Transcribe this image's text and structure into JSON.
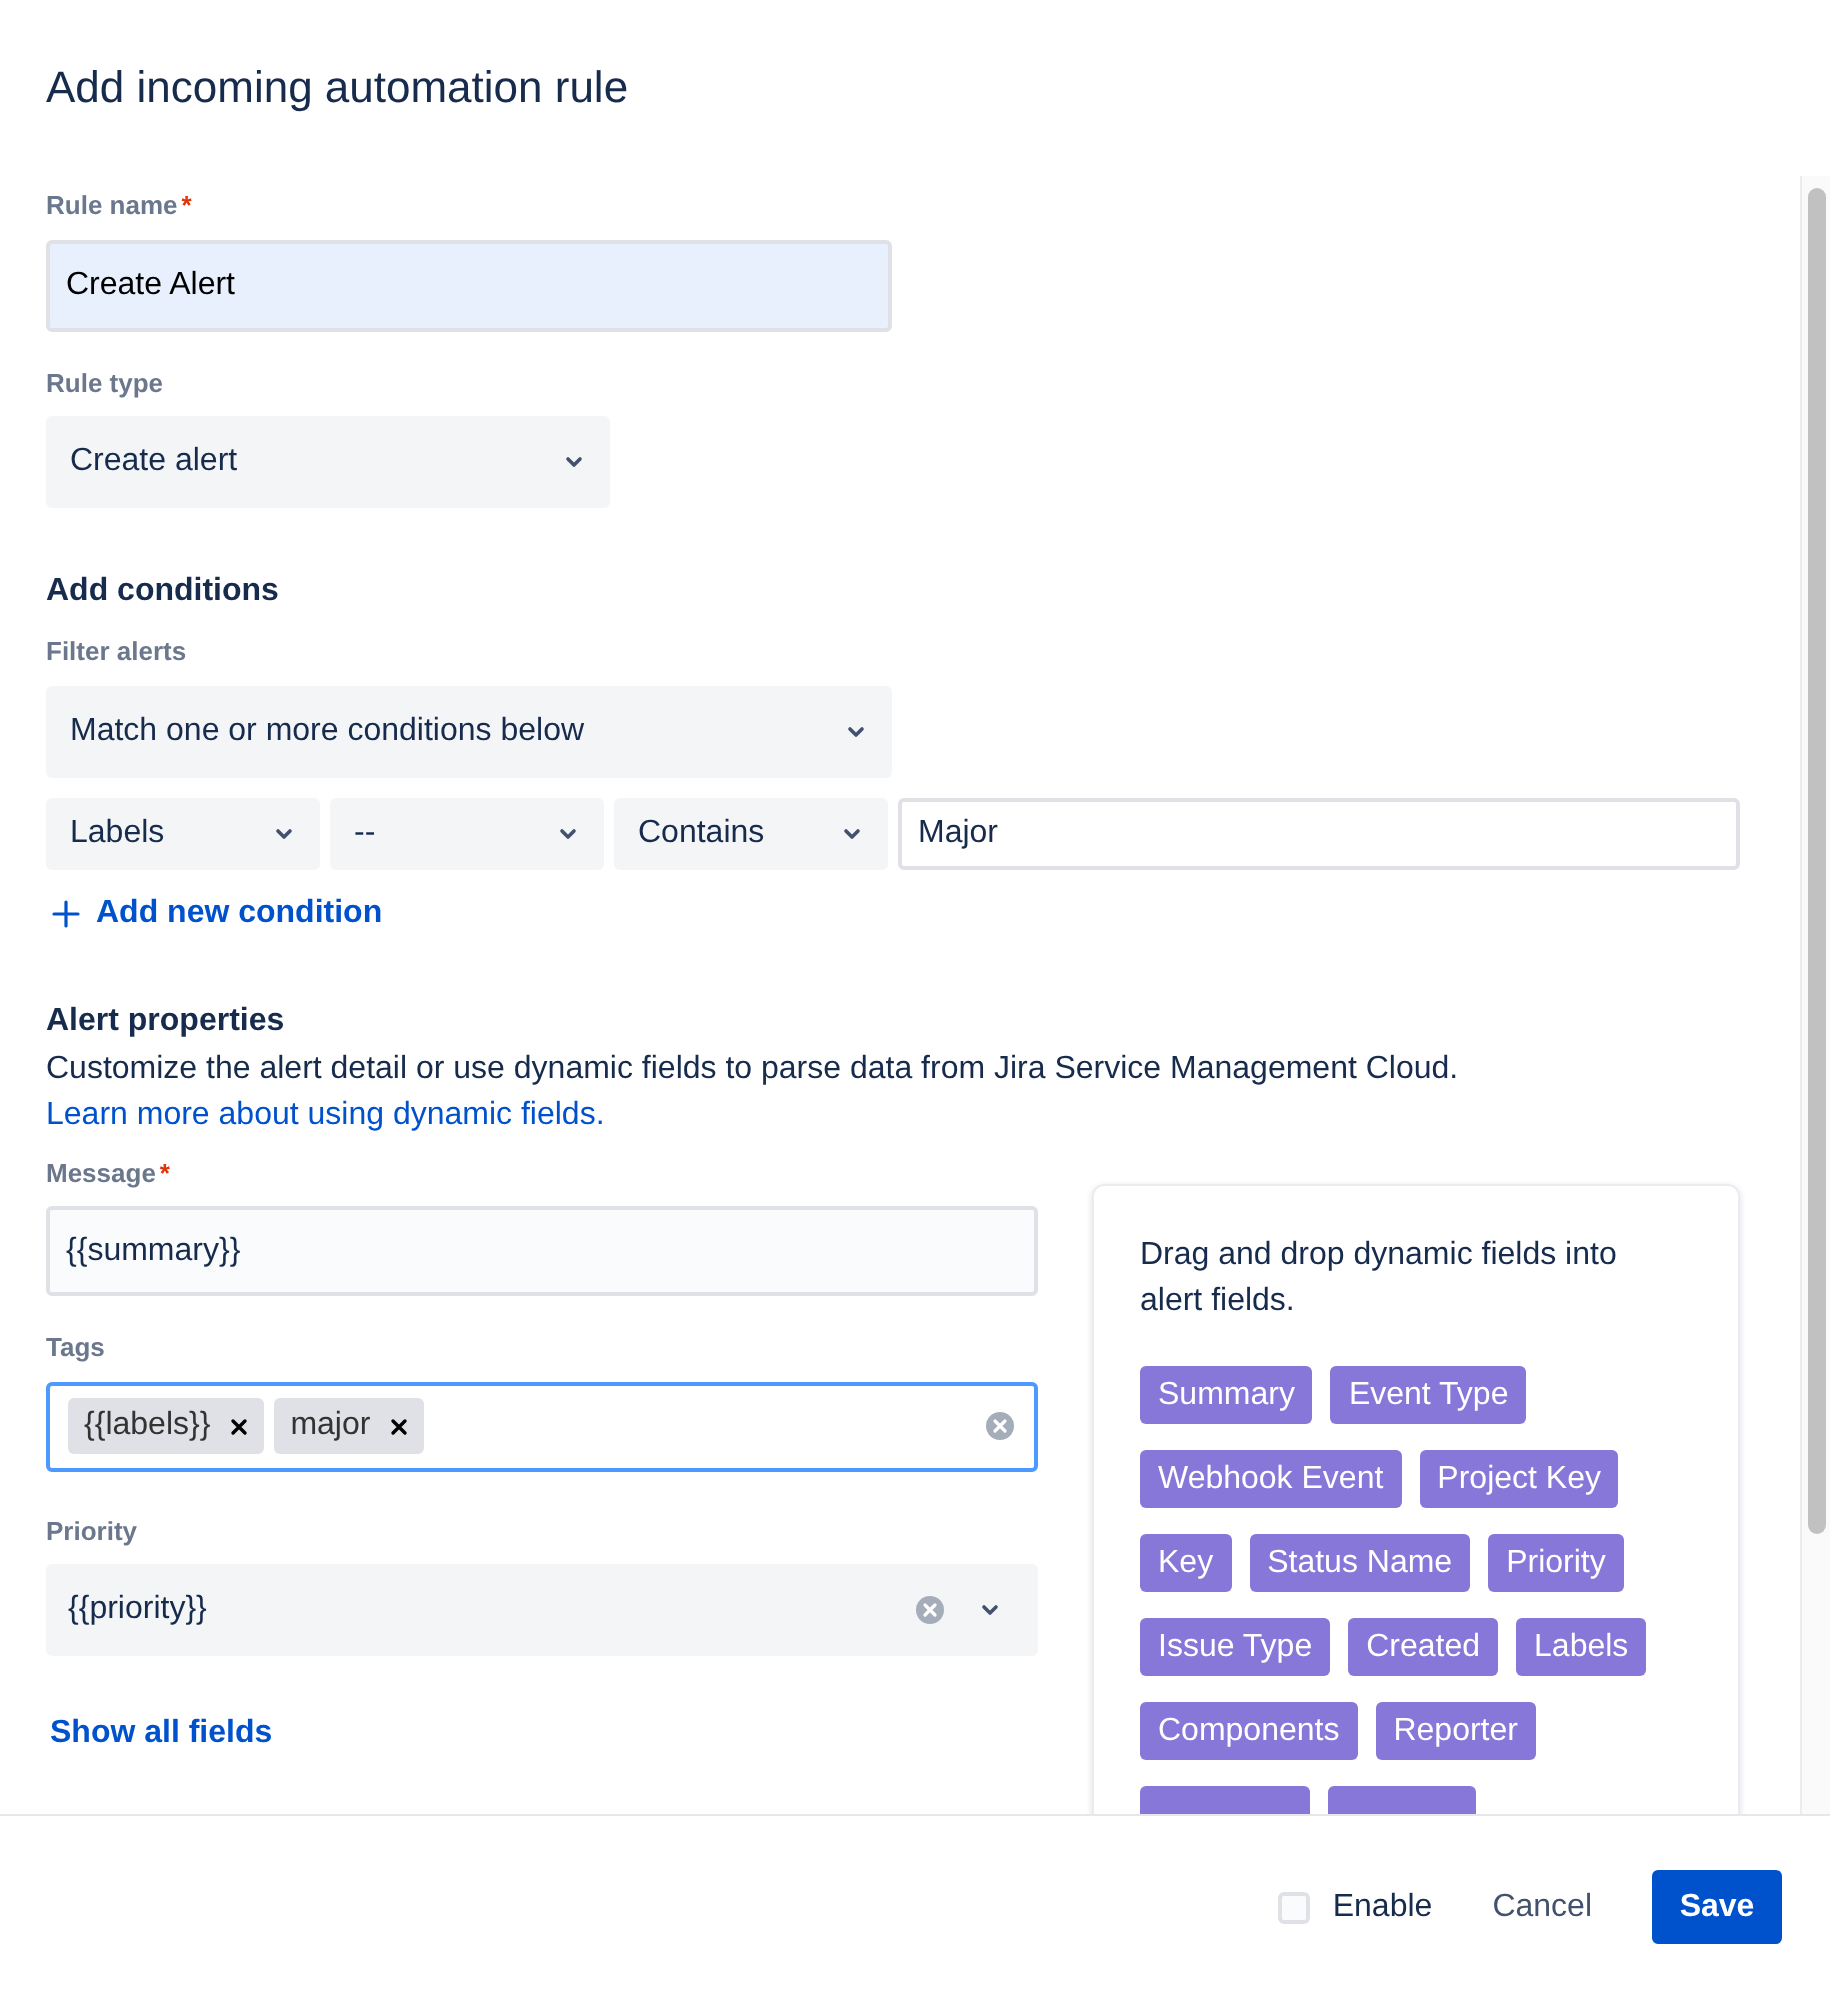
{
  "dialog": {
    "title": "Add incoming automation rule"
  },
  "rule_name": {
    "label": "Rule name",
    "required_mark": "*",
    "value": "Create Alert"
  },
  "rule_type": {
    "label": "Rule type",
    "value": "Create alert"
  },
  "conditions": {
    "heading": "Add conditions",
    "filter_label": "Filter alerts",
    "match": "Match one or more conditions below",
    "rows": [
      {
        "field": "Labels",
        "modifier": "--",
        "operator": "Contains",
        "value": "Major"
      }
    ],
    "add_button": "Add new condition"
  },
  "alert_properties": {
    "heading": "Alert properties",
    "description": "Customize the alert detail or use dynamic fields to parse data from Jira Service Management Cloud.",
    "link": "Learn more about using dynamic fields."
  },
  "message": {
    "label": "Message",
    "required_mark": "*",
    "value": "{{summary}}"
  },
  "tags": {
    "label": "Tags",
    "chips": [
      "{{labels}}",
      "major"
    ]
  },
  "priority": {
    "label": "Priority",
    "value": "{{priority}}"
  },
  "show_all": "Show all fields",
  "dynamic_fields": {
    "hint": "Drag and drop dynamic fields into alert fields.",
    "chips": [
      "Summary",
      "Event Type",
      "Webhook Event",
      "Project Key",
      "Key",
      "Status Name",
      "Priority",
      "Issue Type",
      "Created",
      "Labels",
      "Components",
      "Reporter"
    ]
  },
  "footer": {
    "enable": {
      "label": "Enable",
      "checked": false
    },
    "cancel": "Cancel",
    "save": "Save"
  }
}
